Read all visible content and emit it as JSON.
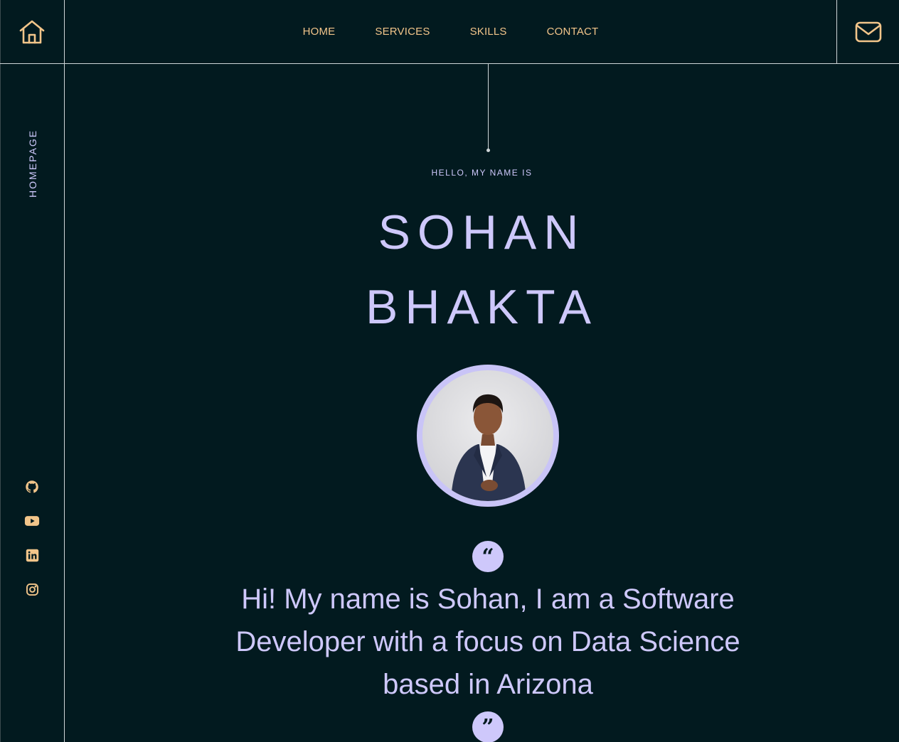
{
  "nav": {
    "items": [
      {
        "label": "HOME"
      },
      {
        "label": "SERVICES"
      },
      {
        "label": "SKILLS"
      },
      {
        "label": "CONTACT"
      }
    ]
  },
  "sidebar": {
    "label": "HOMEPAGE",
    "socials": [
      {
        "icon": "github-icon"
      },
      {
        "icon": "youtube-icon"
      },
      {
        "icon": "linkedin-icon"
      },
      {
        "icon": "instagram-icon"
      }
    ]
  },
  "hero": {
    "greeting": "HELLO, MY NAME IS",
    "first_name": "SOHAN",
    "last_name": "BHAKTA",
    "quote": "Hi! My name is Sohan, I am a Software Developer with a focus on Data Science based in Arizona"
  },
  "colors": {
    "background": "#021a1f",
    "accent": "#f2c58a",
    "lavender": "#cec8fb"
  }
}
